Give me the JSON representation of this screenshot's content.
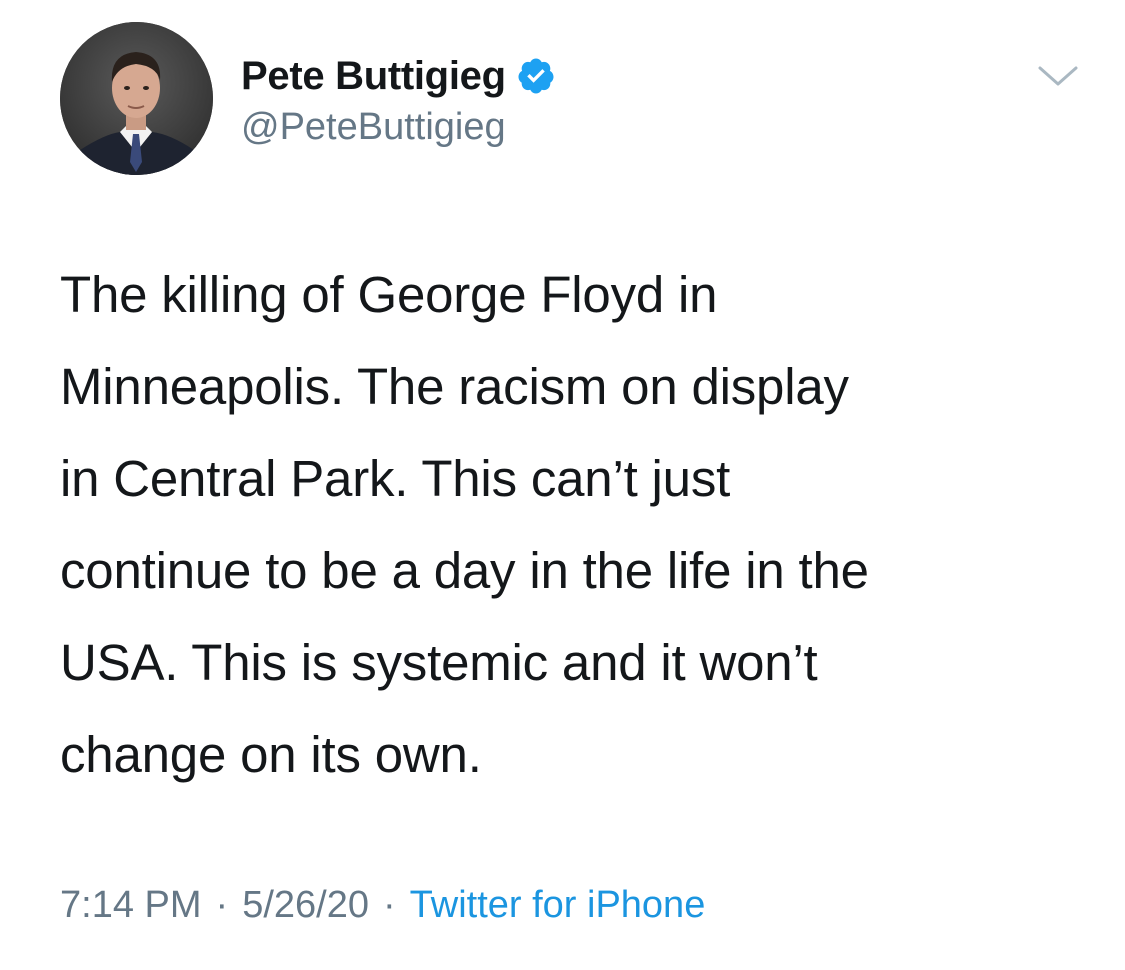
{
  "tweet": {
    "author": {
      "display_name": "Pete Buttigieg",
      "handle": "@PeteButtigieg",
      "verified": true,
      "verified_color": "#1da1f2"
    },
    "text": "The killing of George Floyd in\nMinneapolis. The racism on display\nin Central Park. This can’t just\ncontinue to be a day in the life in the\nUSA. This is systemic and it won’t\nchange on its own.",
    "time": "7:14 PM",
    "date": "5/26/20",
    "separator": "·",
    "source": "Twitter for iPhone",
    "source_color": "#1b95e0"
  },
  "icons": {
    "verified": "verified-badge-icon",
    "menu": "chevron-down-icon"
  }
}
